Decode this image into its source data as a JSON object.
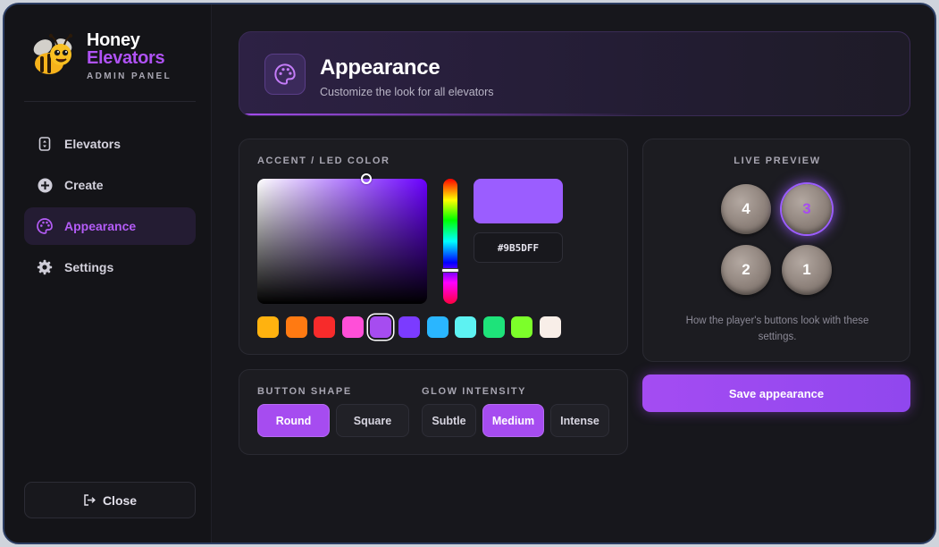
{
  "brand": {
    "name_line1": "Honey",
    "name_line2": "Elevators",
    "subtitle": "ADMIN PANEL"
  },
  "sidebar": {
    "items": [
      {
        "label": "Elevators",
        "icon": "elevator-icon",
        "active": false
      },
      {
        "label": "Create",
        "icon": "plus-circle-icon",
        "active": false
      },
      {
        "label": "Appearance",
        "icon": "palette-icon",
        "active": true
      },
      {
        "label": "Settings",
        "icon": "gear-icon",
        "active": false
      }
    ],
    "close_label": "Close"
  },
  "header": {
    "title": "Appearance",
    "subtitle": "Customize the look for all elevators",
    "icon": "palette-icon"
  },
  "color": {
    "section_label": "ACCENT / LED COLOR",
    "hex_value": "#9B5DFF",
    "selected_color": "#9B5DFF",
    "sv_saturation": 0.64,
    "sv_value": 1.0,
    "hue_fraction": 0.73,
    "presets": [
      "#FFB20F",
      "#FF7A12",
      "#F72B2B",
      "#FF4FD8",
      "#A64CF0",
      "#7B3BFF",
      "#2AB6FF",
      "#5DF2F2",
      "#1EE37A",
      "#7CFF2A",
      "#F8EEE8"
    ],
    "selected_preset_index": 4
  },
  "button_shape": {
    "label": "BUTTON SHAPE",
    "options": [
      "Round",
      "Square"
    ],
    "selected": "Round"
  },
  "glow": {
    "label": "GLOW INTENSITY",
    "options": [
      "Subtle",
      "Medium",
      "Intense"
    ],
    "selected": "Medium"
  },
  "preview": {
    "label": "LIVE PREVIEW",
    "buttons": [
      {
        "floor": "4",
        "lit": false
      },
      {
        "floor": "3",
        "lit": true
      },
      {
        "floor": "2",
        "lit": false
      },
      {
        "floor": "1",
        "lit": false
      }
    ],
    "caption": "How the player's buttons look with these settings."
  },
  "save_label": "Save appearance",
  "colors": {
    "accent": "#A64CF0",
    "background": "#17171C",
    "panel": "#1C1C21"
  }
}
